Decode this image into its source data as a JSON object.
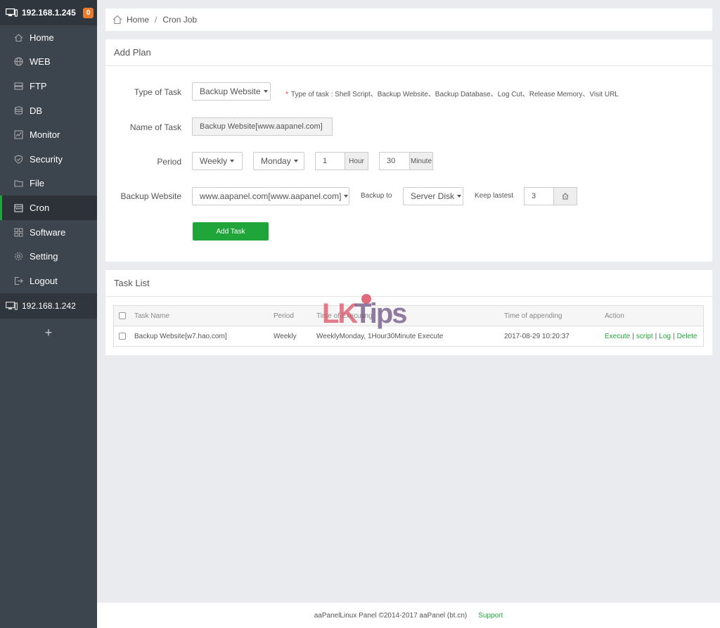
{
  "sidebar": {
    "server": "192.168.1.245",
    "badge": "0",
    "items": [
      {
        "label": "Home",
        "icon": "home-icon"
      },
      {
        "label": "WEB",
        "icon": "globe-icon"
      },
      {
        "label": "FTP",
        "icon": "ftp-icon"
      },
      {
        "label": "DB",
        "icon": "database-icon"
      },
      {
        "label": "Monitor",
        "icon": "monitor-icon"
      },
      {
        "label": "Security",
        "icon": "shield-icon"
      },
      {
        "label": "File",
        "icon": "folder-icon"
      },
      {
        "label": "Cron",
        "icon": "calendar-icon"
      },
      {
        "label": "Software",
        "icon": "grid-icon"
      },
      {
        "label": "Setting",
        "icon": "gear-icon"
      },
      {
        "label": "Logout",
        "icon": "logout-icon"
      }
    ],
    "active_index": 7,
    "server2": "192.168.1.242",
    "add": "+"
  },
  "breadcrumb": {
    "home": "Home",
    "sep": "/",
    "current": "Cron Job"
  },
  "plan": {
    "title": "Add Plan",
    "type_label": "Type of Task",
    "type_value": "Backup Website",
    "type_hint": "Type of task : Shell Script、Backup Website、Backup Database、Log Cut、Release Memory、Visit URL",
    "hint_star": "*",
    "name_label": "Name of Task",
    "name_value": "Backup Website[www.aapanel.com]",
    "period_label": "Period",
    "period_value": "Weekly",
    "day_value": "Monday",
    "hour_value": "1",
    "hour_unit": "Hour",
    "minute_value": "30",
    "minute_unit": "Minute",
    "site_label": "Backup Website",
    "site_value": "www.aapanel.com[www.aapanel.com]",
    "backup_to_label": "Backup to",
    "backup_to_value": "Server Disk",
    "keep_label": "Keep lastest",
    "keep_value": "3",
    "add_button": "Add Task"
  },
  "tasks": {
    "title": "Task List",
    "columns": [
      "Task Name",
      "Period",
      "Time of Executing",
      "Time of appending",
      "Action"
    ],
    "rows": [
      {
        "name": "Backup Website[w7.hao.com]",
        "period": "Weekly",
        "executing": "WeeklyMonday, 1Hour30Minute Execute",
        "appending": "2017-08-29 10:20:37",
        "actions": [
          "Execute",
          "script",
          "Log",
          "Delete"
        ]
      }
    ],
    "separator": "|"
  },
  "watermark": {
    "part1": "LK",
    "part2": "Tips"
  },
  "footer": {
    "copyright": "aaPanelLinux Panel ©2014-2017 aaPanel (bt.cn)",
    "support": "Support"
  },
  "colors": {
    "sidebar": "#3c444d",
    "accent": "#20a53a",
    "badge": "#e97b2e"
  }
}
